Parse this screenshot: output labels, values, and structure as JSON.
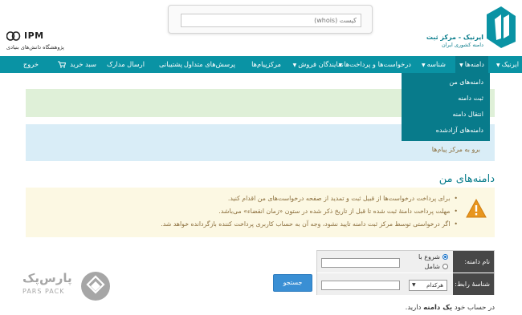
{
  "header": {
    "whois_placeholder": "کیست (whois)",
    "brand_title": "ایرنیک - مرکز ثبت",
    "brand_subtitle_1": "دامنه کشوری ایران",
    "brand_subtitle_2": "",
    "ipm_logo_text": "IPM",
    "ipm_subtitle": "پژوهشگاه دانش‌های بنیادی"
  },
  "nav": {
    "items": [
      {
        "label": "ایرنیک",
        "has_caret": true
      },
      {
        "label": "دامنه‌ها",
        "has_caret": true
      },
      {
        "label": "شناسه",
        "has_caret": true
      },
      {
        "label": "درخواست‌ها و پرداخت‌ها",
        "has_caret": true
      },
      {
        "label": "نمایندگان فروش",
        "has_caret": true
      },
      {
        "label": "مرکزپیام‌ها",
        "has_caret": false
      },
      {
        "label": "پرسش‌های متداول",
        "has_caret": false
      },
      {
        "label": "پشتیبانی",
        "has_caret": false
      },
      {
        "label": "ارسال مدارک",
        "has_caret": false
      },
      {
        "label": "سبد خرید",
        "has_caret": false
      },
      {
        "label": "خروج",
        "has_caret": false
      }
    ],
    "dropdown": [
      "دامنه‌های من",
      "ثبت دامنه",
      "انتقال دامنه",
      "دامنه‌های آزادشده"
    ]
  },
  "alerts": {
    "info_link": "برو به مرکز پیام‌ها"
  },
  "main": {
    "title": "دامنه‌های من",
    "warnings": [
      "برای پرداخت درخواست‌ها از قبیل ثبت و تمدید از صفحه درخواست‌های من اقدام کنید.",
      "مهلت پرداخت دامنهٔ ثبت شده تا قبل از تاریخ ذکر شده در ستون «زمان انقضاء» می‌باشد.",
      "اگر درخواستی توسط مرکز ثبت دامنه تایید نشود، وجه آن به حساب کاربری پرداخت کننده بازگردانده خواهد شد."
    ]
  },
  "filter": {
    "domain_label": "نام دامنه:",
    "contact_label": "شناسهٔ رابط:",
    "option_starts": "شروع با",
    "option_contains": "شامل",
    "selected_option": "starts",
    "role_select_value": "هرکدام",
    "search_button": "جستجو"
  },
  "footer": {
    "prefix": "در حساب خود",
    "count": "یک دامنه",
    "suffix": "دارید."
  },
  "watermark": {
    "fa": "پارس‌پک",
    "en": "PARS PACK"
  },
  "colors": {
    "primary": "#0a93a4",
    "primary_dark": "#087b8b",
    "success_bg": "#dff0d8",
    "info_bg": "#d9edf7",
    "warning_bg": "#fcf8e3",
    "warning_text": "#8a6d3b",
    "button": "#3a8fd4"
  }
}
